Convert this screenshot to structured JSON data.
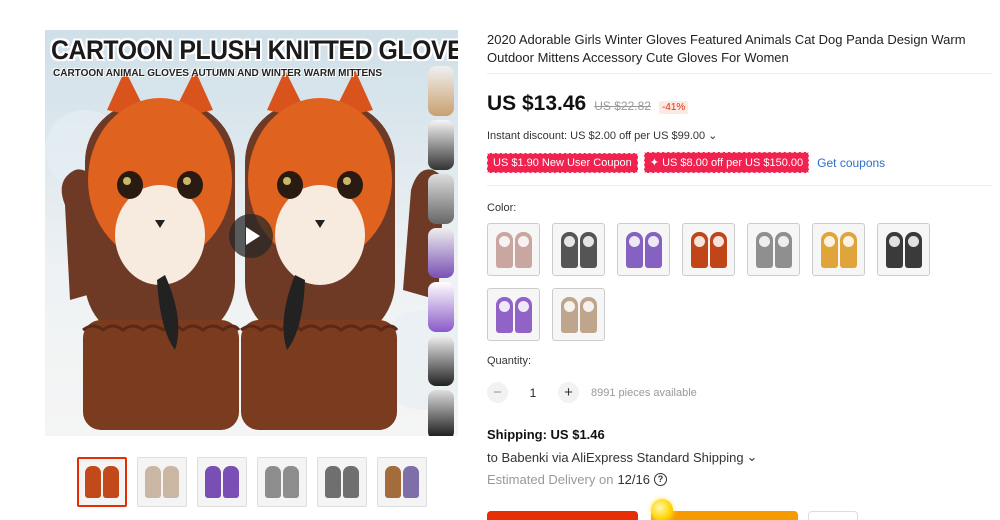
{
  "gallery": {
    "banner_title": "CARTOON PLUSH KNITTED GLOVES",
    "banner_subtitle": "CARTOON ANIMAL GLOVES AUTUMN AND WINTER WARM MITTENS",
    "side_variants": [
      "owl",
      "panda",
      "wolf",
      "owl-purple",
      "fox-purple",
      "panda-black",
      "raccoon"
    ],
    "thumbnails": [
      {
        "name": "fox",
        "colors": [
          "#c2491a",
          "#6a3a22"
        ]
      },
      {
        "name": "owl-tan",
        "colors": [
          "#c9b7a4",
          "#7d5b45"
        ]
      },
      {
        "name": "owl-purple",
        "colors": [
          "#7a4fb5",
          "#4a3a35"
        ]
      },
      {
        "name": "wolf-gray",
        "colors": [
          "#8d8d8d",
          "#555"
        ]
      },
      {
        "name": "panda-gray",
        "colors": [
          "#6f6f6f",
          "#333"
        ]
      },
      {
        "name": "assorted",
        "colors": [
          "#a56c3b",
          "#7e6fa8"
        ]
      }
    ]
  },
  "product": {
    "title": "2020 Adorable Girls Winter Gloves Featured Animals Cat Dog Panda Design Warm Outdoor Mittens Accessory Cute Gloves For Women",
    "price": "US $13.46",
    "old_price": "US $22.82",
    "discount": "-41%",
    "instant_discount": "Instant discount: US $2.00 off per US $99.00",
    "coupons": [
      "US $1.90 New User Coupon",
      "✦ US $8.00 off per US $150.00"
    ],
    "get_coupons": "Get coupons",
    "color_label": "Color:",
    "colors": [
      {
        "name": "pink-panda",
        "a": "#c9a6a0",
        "b": "#4a4040"
      },
      {
        "name": "panda",
        "a": "#555",
        "b": "#222"
      },
      {
        "name": "purple-cat",
        "a": "#8561c2",
        "b": "#3d3535"
      },
      {
        "name": "fox",
        "a": "#c0461a",
        "b": "#5a2d18"
      },
      {
        "name": "gray-wolf",
        "a": "#8f8f8f",
        "b": "#4f4f4f"
      },
      {
        "name": "yellow-owl",
        "a": "#e0a53a",
        "b": "#6c5a4a"
      },
      {
        "name": "black-cat",
        "a": "#3a3a3a",
        "b": "#1c1c1c"
      },
      {
        "name": "purple-owl",
        "a": "#9263c7",
        "b": "#5a4a42"
      },
      {
        "name": "tan-owl",
        "a": "#bfa58b",
        "b": "#6b5040"
      }
    ],
    "quantity_label": "Quantity:",
    "quantity": "1",
    "available": "8991 pieces available",
    "shipping": "Shipping: US $1.46",
    "ship_to": "to Babenki via AliExpress Standard Shipping",
    "delivery_prefix": "Estimated Delivery on",
    "delivery_date": "12/16"
  }
}
